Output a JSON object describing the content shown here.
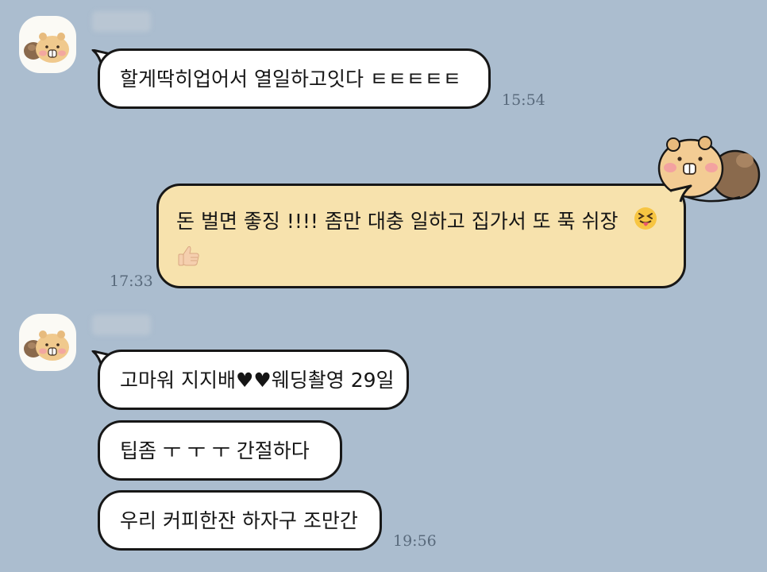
{
  "chat": {
    "messages": [
      {
        "side": "left",
        "text": "할게딱히업어서 열일하고잇다 ㅌㅌㅌㅌㅌ",
        "time": "15:54"
      },
      {
        "side": "right",
        "text": "돈 벌면 좋징 !!!!  좀만 대충 일하고 집가서 또 푹 쉬장",
        "emoji": [
          "squinting-tongue-emoji",
          "thumbs-up-emoji"
        ],
        "time": "17:33"
      },
      {
        "side": "left",
        "text": "고마워 지지배♥♥웨딩촬영  29일"
      },
      {
        "side": "left",
        "text": "팁좀 ㅜ ㅜ ㅜ 간절하다"
      },
      {
        "side": "left",
        "text": "우리 커피한잔 하자구 조만간",
        "time": "19:56"
      }
    ]
  },
  "colors": {
    "background": "#abbdcf",
    "incoming_bubble": "#ffffff",
    "outgoing_bubble": "#f7e2ad",
    "bubble_border": "#171717",
    "timestamp": "#596a7c"
  }
}
